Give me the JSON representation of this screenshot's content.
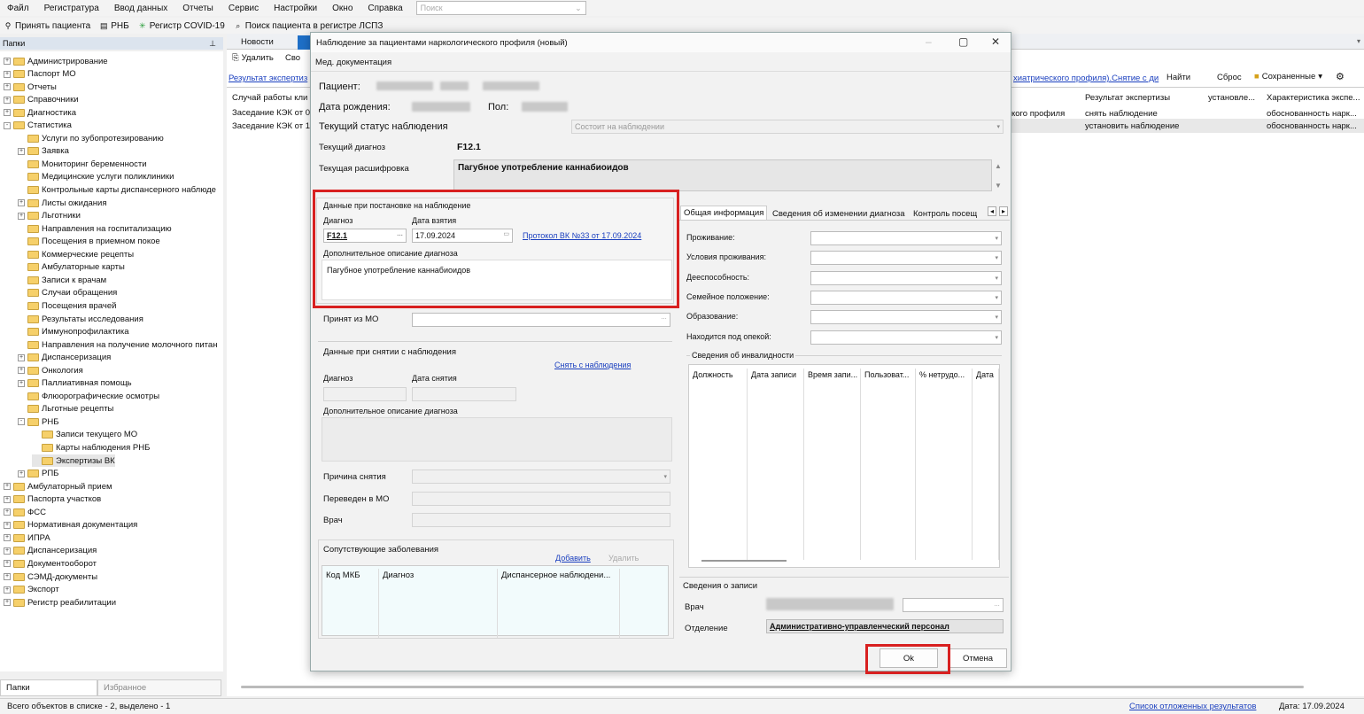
{
  "menu": [
    "Файл",
    "Регистратура",
    "Ввод данных",
    "Отчеты",
    "Сервис",
    "Настройки",
    "Окно",
    "Справка"
  ],
  "search_placeholder": "Поиск",
  "toolbar": [
    "Принять пациента",
    "РНБ",
    "Регистр COVID-19",
    "Поиск пациента в регистре ЛСПЗ"
  ],
  "folders_title": "Папки",
  "pin_icon": "pin-icon",
  "tree": [
    {
      "label": "Администрирование",
      "level": 0,
      "exp": "+"
    },
    {
      "label": "Паспорт МО",
      "level": 0,
      "exp": "+"
    },
    {
      "label": "Отчеты",
      "level": 0,
      "exp": "+"
    },
    {
      "label": "Справочники",
      "level": 0,
      "exp": "+"
    },
    {
      "label": "Диагностика",
      "level": 0,
      "exp": "+"
    },
    {
      "label": "Статистика",
      "level": 0,
      "exp": "-"
    },
    {
      "label": "Услуги по зубопротезированию",
      "level": 1,
      "exp": ""
    },
    {
      "label": "Заявка",
      "level": 1,
      "exp": "+"
    },
    {
      "label": "Мониторинг беременности",
      "level": 1,
      "exp": ""
    },
    {
      "label": "Медицинские услуги поликлиники",
      "level": 1,
      "exp": ""
    },
    {
      "label": "Контрольные карты диспансерного наблюде",
      "level": 1,
      "exp": ""
    },
    {
      "label": "Листы ожидания",
      "level": 1,
      "exp": "+"
    },
    {
      "label": "Льготники",
      "level": 1,
      "exp": "+"
    },
    {
      "label": "Направления на госпитализацию",
      "level": 1,
      "exp": ""
    },
    {
      "label": "Посещения в приемном покое",
      "level": 1,
      "exp": ""
    },
    {
      "label": "Коммерческие рецепты",
      "level": 1,
      "exp": ""
    },
    {
      "label": "Амбулаторные карты",
      "level": 1,
      "exp": ""
    },
    {
      "label": "Записи к врачам",
      "level": 1,
      "exp": ""
    },
    {
      "label": "Случаи обращения",
      "level": 1,
      "exp": ""
    },
    {
      "label": "Посещения врачей",
      "level": 1,
      "exp": ""
    },
    {
      "label": "Результаты исследования",
      "level": 1,
      "exp": ""
    },
    {
      "label": "Иммунопрофилактика",
      "level": 1,
      "exp": ""
    },
    {
      "label": "Направления на получение молочного питан",
      "level": 1,
      "exp": ""
    },
    {
      "label": "Диспансеризация",
      "level": 1,
      "exp": "+"
    },
    {
      "label": "Онкология",
      "level": 1,
      "exp": "+"
    },
    {
      "label": "Паллиативная помощь",
      "level": 1,
      "exp": "+"
    },
    {
      "label": "Флюорографические осмотры",
      "level": 1,
      "exp": ""
    },
    {
      "label": "Льготные рецепты",
      "level": 1,
      "exp": ""
    },
    {
      "label": "РНБ",
      "level": 1,
      "exp": "-"
    },
    {
      "label": "Записи текущего МО",
      "level": 2,
      "exp": ""
    },
    {
      "label": "Карты наблюдения РНБ",
      "level": 2,
      "exp": ""
    },
    {
      "label": "Экспертизы ВК",
      "level": 2,
      "exp": ""
    },
    {
      "label": "РПБ",
      "level": 1,
      "exp": "+"
    },
    {
      "label": "Амбулаторный прием",
      "level": 0,
      "exp": "+"
    },
    {
      "label": "Паспорта участков",
      "level": 0,
      "exp": "+"
    },
    {
      "label": "ФСС",
      "level": 0,
      "exp": "+"
    },
    {
      "label": "Нормативная документация",
      "level": 0,
      "exp": "+"
    },
    {
      "label": "ИПРА",
      "level": 0,
      "exp": "+"
    },
    {
      "label": "Диспансеризация",
      "level": 0,
      "exp": "+"
    },
    {
      "label": "Документооборот",
      "level": 0,
      "exp": "+"
    },
    {
      "label": "СЭМД-документы",
      "level": 0,
      "exp": "+"
    },
    {
      "label": "Экспорт",
      "level": 0,
      "exp": "+"
    },
    {
      "label": "Регистр реабилитации",
      "level": 0,
      "exp": "+"
    }
  ],
  "bottom_tabs": [
    "Папки",
    "Избранное"
  ],
  "status": {
    "left": "Всего объектов в списке - 2, выделено - 1",
    "link": "Список отложенных результатов",
    "date": "Дата: 17.09.2024"
  },
  "bg": {
    "tab_news": "Новости",
    "delete": "Удалить",
    "sv": "Сво",
    "link_left": "Результат экспертиз",
    "link_right": "хиатрического профиля).Снятие с ди",
    "find": "Найти",
    "reset": "Сброс",
    "saved": "Сохраненные",
    "rows_left": [
      "Случай работы кли",
      "Заседание КЭК от 04",
      "Заседание КЭК от 17"
    ],
    "mid": "кого профиля",
    "col_result": "Результат экспертизы",
    "col_set": "установле...",
    "col_char": "Характеристика экспе...",
    "r1": [
      "снять наблюдение",
      "обоснованность нарк..."
    ],
    "r2": [
      "установить наблюдение",
      "обоснованность нарк..."
    ]
  },
  "dialog": {
    "title": "Наблюдение за пациентами наркологического профиля (новый)",
    "med": "Мед. документация",
    "patient": "Пациент:",
    "dob": "Дата рождения:",
    "sex": "Пол:",
    "cur_status": "Текущий статус наблюдения",
    "status_val": "Состоит на наблюдении",
    "cur_dx": "Текущий диагноз",
    "cur_dx_val": "F12.1",
    "cur_decode": "Текущая расшифровка",
    "cur_decode_val": "Пагубное употребление каннабиоидов",
    "reg_group": "Данные при постановке на наблюдение",
    "dx": "Диагноз",
    "date_taken": "Дата взятия",
    "dx_val": "F12.1",
    "date_val": "17.09.2024",
    "protocol": "Протокол ВК №33 от 17.09.2024",
    "extra_desc": "Дополнительное описание диагноза",
    "extra_val": "Пагубное употребление каннабиоидов",
    "from_mo": "Принят из МО",
    "remove_group": "Данные при снятии с наблюдения",
    "remove_link": "Снять с наблюдения",
    "dx2": "Диагноз",
    "date_remove": "Дата снятия",
    "extra_desc2": "Дополнительное описание диагноза",
    "reason": "Причина снятия",
    "transferred": "Переведен в МО",
    "doctor": "Врач",
    "comorb": "Сопутствующие заболевания",
    "add": "Добавить",
    "del": "Удалить",
    "comorb_cols": [
      "Код МКБ",
      "Диагноз",
      "Диспансерное наблюдени..."
    ],
    "tabs": [
      "Общая информация",
      "Сведения об изменении диагноза",
      "Контроль посещ"
    ],
    "info_labels": [
      "Проживание:",
      "Условия проживания:",
      "Дееспособность:",
      "Семейное положение:",
      "Образование:",
      "Находится под опекой:"
    ],
    "disab": "Сведения об инвалидности",
    "disab_cols": [
      "Должность",
      "Дата записи",
      "Время запи...",
      "Пользоват...",
      "% нетрудо...",
      "Дата"
    ],
    "rec_info": "Сведения о записи",
    "rec_doctor": "Врач",
    "rec_dept": "Отделение",
    "dept_val": "Административно-управленческий персонал",
    "ok": "Ok",
    "cancel": "Отмена"
  }
}
